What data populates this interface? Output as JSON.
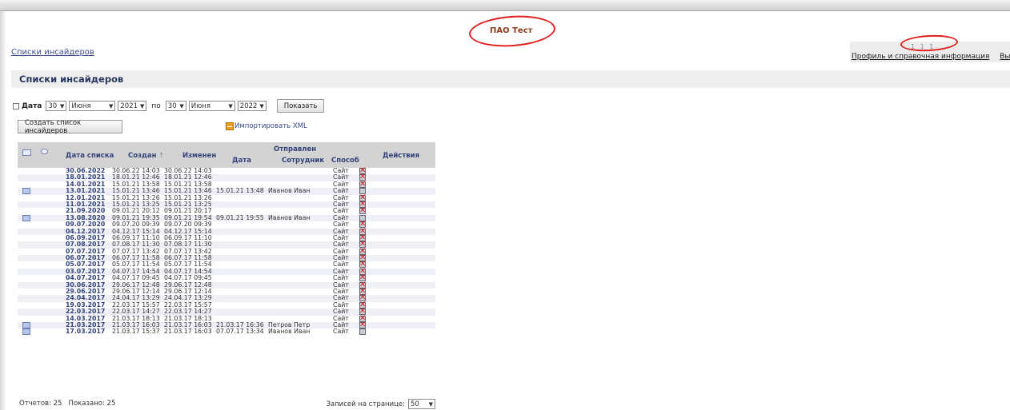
{
  "header": {
    "company": "ПАО Тест",
    "user_id": "1 1 1",
    "links": [
      "Профиль и справочная информация",
      "Выход"
    ],
    "breadcrumb": "Списки инсайдеров"
  },
  "page": {
    "title": "Списки инсайдеров"
  },
  "filter": {
    "checkbox_label": "Дата",
    "from_day": "30",
    "from_month": "Июня",
    "from_year": "2021",
    "to_label": "по",
    "to_day": "30",
    "to_month": "Июня",
    "to_year": "2022",
    "show_button": "Показать"
  },
  "actions": {
    "create_button": "Создать список инсайдеров",
    "import_link": "Импортировать XML"
  },
  "table": {
    "headers": {
      "list_date": "Дата списка",
      "created": "Создан",
      "created_sort": "↑",
      "changed": "Изменен",
      "sent": "Отправлен",
      "sent_date": "Дата",
      "sent_employee": "Сотрудник",
      "method": "Способ",
      "actions": "Действия"
    },
    "rows": [
      {
        "list_date": "30.06.2022",
        "created": "30.06.22 14:03",
        "changed": "30.06.22 14:03",
        "sent_date": "",
        "employee": "",
        "method": "Сайт",
        "mail": false,
        "delete": true
      },
      {
        "list_date": "18.01.2021",
        "created": "18.01.21 12:46",
        "changed": "18.01.21 12:46",
        "sent_date": "",
        "employee": "",
        "method": "Сайт",
        "mail": false,
        "delete": true
      },
      {
        "list_date": "14.01.2021",
        "created": "15.01.21 13:58",
        "changed": "15.01.21 13:58",
        "sent_date": "",
        "employee": "",
        "method": "Сайт",
        "mail": false,
        "delete": true
      },
      {
        "list_date": "13.01.2021",
        "created": "15.01.21 13:46",
        "changed": "15.01.21 13:46",
        "sent_date": "15.01.21 13:48",
        "employee": "Иванов Иван",
        "method": "Сайт",
        "mail": true,
        "delete": false
      },
      {
        "list_date": "12.01.2021",
        "created": "15.01.21 13:26",
        "changed": "15.01.21 13:26",
        "sent_date": "",
        "employee": "",
        "method": "Сайт",
        "mail": false,
        "delete": true
      },
      {
        "list_date": "11.01.2021",
        "created": "15.01.21 13:25",
        "changed": "15.01.21 13:25",
        "sent_date": "",
        "employee": "",
        "method": "Сайт",
        "mail": false,
        "delete": true
      },
      {
        "list_date": "21.09.2020",
        "created": "09.01.21 20:12",
        "changed": "09.01.21 20:17",
        "sent_date": "",
        "employee": "",
        "method": "Сайт",
        "mail": false,
        "delete": true
      },
      {
        "list_date": "13.08.2020",
        "created": "09.01.21 19:35",
        "changed": "09.01.21 19:54",
        "sent_date": "09.01.21 19:55",
        "employee": "Иванов Иван",
        "method": "Сайт",
        "mail": true,
        "delete": false
      },
      {
        "list_date": "09.07.2020",
        "created": "09.07.20 09:39",
        "changed": "09.07.20 09:39",
        "sent_date": "",
        "employee": "",
        "method": "Сайт",
        "mail": false,
        "delete": true
      },
      {
        "list_date": "04.12.2017",
        "created": "04.12.17 15:14",
        "changed": "04.12.17 15:14",
        "sent_date": "",
        "employee": "",
        "method": "Сайт",
        "mail": false,
        "delete": true
      },
      {
        "list_date": "06.09.2017",
        "created": "06.09.17 11:10",
        "changed": "06.09.17 11:10",
        "sent_date": "",
        "employee": "",
        "method": "Сайт",
        "mail": false,
        "delete": true
      },
      {
        "list_date": "07.08.2017",
        "created": "07.08.17 11:30",
        "changed": "07.08.17 11:30",
        "sent_date": "",
        "employee": "",
        "method": "Сайт",
        "mail": false,
        "delete": true
      },
      {
        "list_date": "07.07.2017",
        "created": "07.07.17 13:42",
        "changed": "07.07.17 13:42",
        "sent_date": "",
        "employee": "",
        "method": "Сайт",
        "mail": false,
        "delete": true
      },
      {
        "list_date": "06.07.2017",
        "created": "06.07.17 11:58",
        "changed": "06.07.17 11:58",
        "sent_date": "",
        "employee": "",
        "method": "Сайт",
        "mail": false,
        "delete": true
      },
      {
        "list_date": "05.07.2017",
        "created": "05.07.17 11:54",
        "changed": "05.07.17 11:54",
        "sent_date": "",
        "employee": "",
        "method": "Сайт",
        "mail": false,
        "delete": true
      },
      {
        "list_date": "03.07.2017",
        "created": "04.07.17 14:54",
        "changed": "04.07.17 14:54",
        "sent_date": "",
        "employee": "",
        "method": "Сайт",
        "mail": false,
        "delete": true
      },
      {
        "list_date": "04.07.2017",
        "created": "04.07.17 09:45",
        "changed": "04.07.17 09:45",
        "sent_date": "",
        "employee": "",
        "method": "Сайт",
        "mail": false,
        "delete": true
      },
      {
        "list_date": "30.06.2017",
        "created": "29.06.17 12:48",
        "changed": "29.06.17 12:48",
        "sent_date": "",
        "employee": "",
        "method": "Сайт",
        "mail": false,
        "delete": true
      },
      {
        "list_date": "29.06.2017",
        "created": "29.06.17 12:14",
        "changed": "29.06.17 12:14",
        "sent_date": "",
        "employee": "",
        "method": "Сайт",
        "mail": false,
        "delete": true
      },
      {
        "list_date": "24.04.2017",
        "created": "24.04.17 13:29",
        "changed": "24.04.17 13:29",
        "sent_date": "",
        "employee": "",
        "method": "Сайт",
        "mail": false,
        "delete": true
      },
      {
        "list_date": "19.03.2017",
        "created": "22.03.17 15:57",
        "changed": "22.03.17 15:57",
        "sent_date": "",
        "employee": "",
        "method": "Сайт",
        "mail": false,
        "delete": true
      },
      {
        "list_date": "22.03.2017",
        "created": "22.03.17 14:27",
        "changed": "22.03.17 14:27",
        "sent_date": "",
        "employee": "",
        "method": "Сайт",
        "mail": false,
        "delete": true
      },
      {
        "list_date": "14.03.2017",
        "created": "21.03.17 18:13",
        "changed": "21.03.17 18:13",
        "sent_date": "",
        "employee": "",
        "method": "Сайт",
        "mail": false,
        "delete": true
      },
      {
        "list_date": "21.03.2017",
        "created": "21.03.17 16:03",
        "changed": "21.03.17 16:03",
        "sent_date": "21.03.17 16:36",
        "employee": "Петров Петр",
        "method": "Сайт",
        "mail": true,
        "delete": true
      },
      {
        "list_date": "17.03.2017",
        "created": "21.03.17 15:37",
        "changed": "21.03.17 16:03",
        "sent_date": "07.07.17 13:34",
        "employee": "Иванов Иван",
        "method": "Сайт",
        "mail": true,
        "delete": false
      }
    ]
  },
  "footer": {
    "reports": "Отчетов: 25",
    "shown": "Показано: 25",
    "per_page_label": "Записей на странице:",
    "per_page": "50"
  },
  "colors": {
    "accent": "#27375f",
    "annotation": "#e02020",
    "header_bg": "#d3d3d3",
    "company": "#8b3a1a"
  }
}
